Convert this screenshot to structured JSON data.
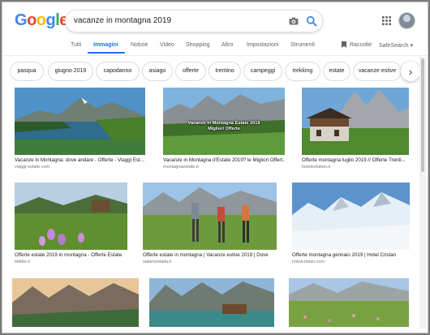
{
  "search": {
    "query": "vacanze in montagna 2019"
  },
  "logo": {
    "letters": [
      "G",
      "o",
      "o",
      "g",
      "l",
      "e"
    ],
    "colors": [
      "#4285f4",
      "#ea4335",
      "#fbbc05",
      "#4285f4",
      "#34a853",
      "#ea4335"
    ]
  },
  "tabs": {
    "items": [
      "Tutti",
      "Immagini",
      "Notizie",
      "Video",
      "Shopping",
      "Altro",
      "Impostazioni",
      "Strumenti"
    ],
    "active": "Immagini",
    "collections": "Raccolte",
    "safesearch": "SafeSearch ▾"
  },
  "chips": [
    "pasqua",
    "giugno 2019",
    "capodanno",
    "asiago",
    "offerte",
    "trentino",
    "campeggi",
    "trekking",
    "estate",
    "vacanze estive"
  ],
  "results": [
    {
      "caption": "Vacanze in Montagna: dove andare - Offerte - Viaggi Est...",
      "source": "viaggi-estate.com"
    },
    {
      "caption": "Vacanze in Montagna d'Estate 2019? le Migliori Offert...",
      "source": "montagnaestate.it",
      "overlay": [
        "Vacanze in Montagna Estate 2019",
        "Migliori Offerte"
      ]
    },
    {
      "caption": "Offerte montagna luglio 2019 // Offerte Trenti...",
      "source": "hotelsolution.it"
    },
    {
      "caption": "Offerte estate 2019 in montagna - Offerte Estate",
      "source": "tiefide.it"
    },
    {
      "caption": "Offerte estate in montagna | Vacanze estive 2019 | Dove",
      "source": "salamontalla.it"
    },
    {
      "caption": "Offerte montagna gennaio 2019 | Hotel Cristan",
      "source": "hotelcristan.com"
    },
    {
      "caption": "",
      "source": ""
    },
    {
      "caption": "",
      "source": ""
    },
    {
      "caption": "",
      "source": ""
    }
  ],
  "icons": {
    "camera": "camera-icon",
    "search": "search-icon",
    "apps": "apps-grid-icon",
    "avatar": "avatar",
    "bookmark": "bookmark-icon",
    "chip_next": "chevron-right-icon"
  },
  "colors": {
    "accent": "#1a73e8",
    "muted": "#5f6368"
  }
}
